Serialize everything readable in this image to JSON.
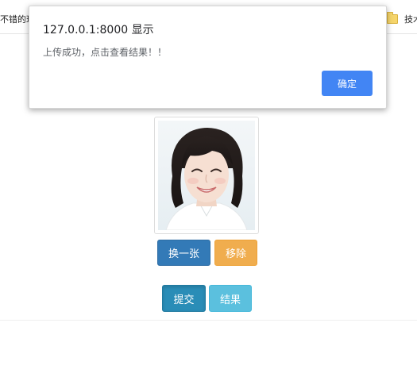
{
  "bookmarks_bar": {
    "left_text": "不错的玩",
    "right_text": "技术"
  },
  "alert": {
    "title": "127.0.0.1:8000 显示",
    "message": "上传成功，点击查看结果！！",
    "ok_label": "确定",
    "ok_color": "#4285f4"
  },
  "photo": {
    "icon": "portrait-photo"
  },
  "actions": {
    "change_label": "换一张",
    "remove_label": "移除",
    "submit_label": "提交",
    "result_label": "结果"
  },
  "colors": {
    "primary": "#337ab7",
    "warning": "#f0ad4e",
    "info": "#5bc0de",
    "submit": "#2a8db7"
  }
}
